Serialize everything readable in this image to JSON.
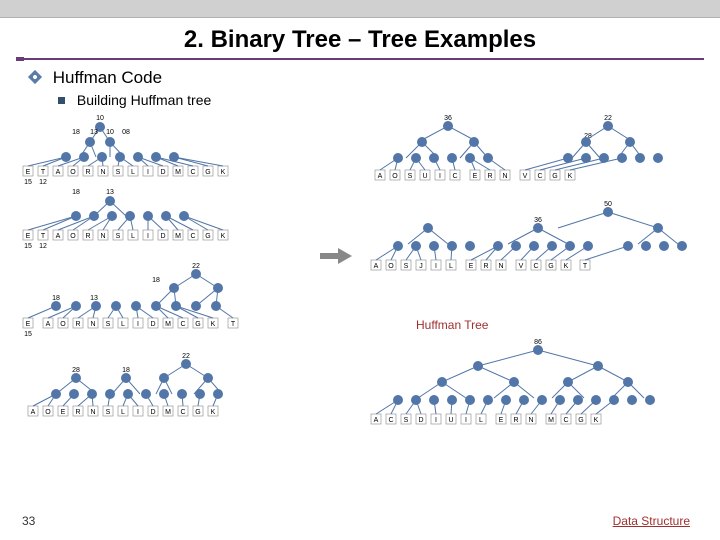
{
  "slide": {
    "title": "2. Binary Tree – Tree Examples",
    "section_heading": "Huffman Code",
    "subheading": "Building Huffman tree",
    "page_number": "33",
    "footer": "Data Structure",
    "annotation": "Huffman Tree"
  },
  "trees": {
    "stage1": {
      "root_val": "10",
      "row_labels_top": [
        "",
        "18",
        "13",
        "10",
        "08"
      ],
      "leaves": [
        "E",
        "T",
        "A",
        "O",
        "R",
        "N",
        "S",
        "L",
        "I",
        "D",
        "M",
        "C",
        "G",
        "K"
      ],
      "leaf_vals": [
        "15",
        "12"
      ]
    },
    "stage2": {
      "root_val": "13",
      "row_labels_top": [
        "",
        "18",
        "13"
      ],
      "leaves": [
        "E",
        "T",
        "A",
        "O",
        "R",
        "N",
        "S",
        "L",
        "I",
        "D",
        "M",
        "C",
        "G",
        "K"
      ],
      "leaf_vals": [
        "15",
        "12"
      ]
    },
    "stage3": {
      "root_val": "22",
      "row_labels": [
        "18",
        "18",
        "13"
      ],
      "leaves": [
        "E",
        "A",
        "O",
        "R",
        "N",
        "S",
        "L",
        "I",
        "D",
        "M",
        "C",
        "G",
        "K",
        "T"
      ],
      "leaf_vals": [
        "15"
      ]
    },
    "stage4": {
      "root_val": "22",
      "row_labels": [
        "28",
        "18"
      ],
      "leaves": [
        "A",
        "O",
        "E",
        "R",
        "N",
        "S",
        "L",
        "I",
        "D",
        "M",
        "C",
        "G",
        "K"
      ]
    },
    "stage5_right_top": {
      "root_vals": [
        "36",
        "22"
      ],
      "sub_val": "28",
      "leaves": [
        "A",
        "O",
        "S",
        "U",
        "I",
        "C",
        "E",
        "R",
        "N",
        "V",
        "C",
        "G",
        "K"
      ]
    },
    "stage6_right_mid": {
      "root_vals": [
        "50",
        "36"
      ],
      "leaves": [
        "A",
        "O",
        "S",
        "J",
        "I",
        "L",
        "E",
        "R",
        "N",
        "V",
        "C",
        "G",
        "K",
        "T"
      ]
    },
    "stage7_right_bottom": {
      "root_val": "86",
      "leaves": [
        "A",
        "C",
        "S",
        "D",
        "I",
        "U",
        "I",
        "L",
        "E",
        "R",
        "N",
        "M",
        "C",
        "G",
        "K"
      ]
    }
  }
}
